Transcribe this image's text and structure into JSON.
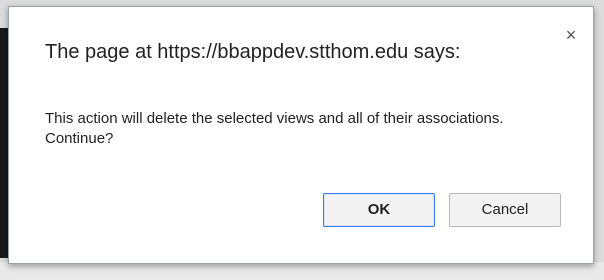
{
  "dialog": {
    "title": "The page at https://bbappdev.stthom.edu says:",
    "close_symbol": "×",
    "message": "This action will delete the selected views and all of their associations. Continue?",
    "ok_label": "OK",
    "cancel_label": "Cancel"
  },
  "colors": {
    "primary_button_border": "#3b78e7",
    "dialog_border": "#9aa3ad"
  }
}
